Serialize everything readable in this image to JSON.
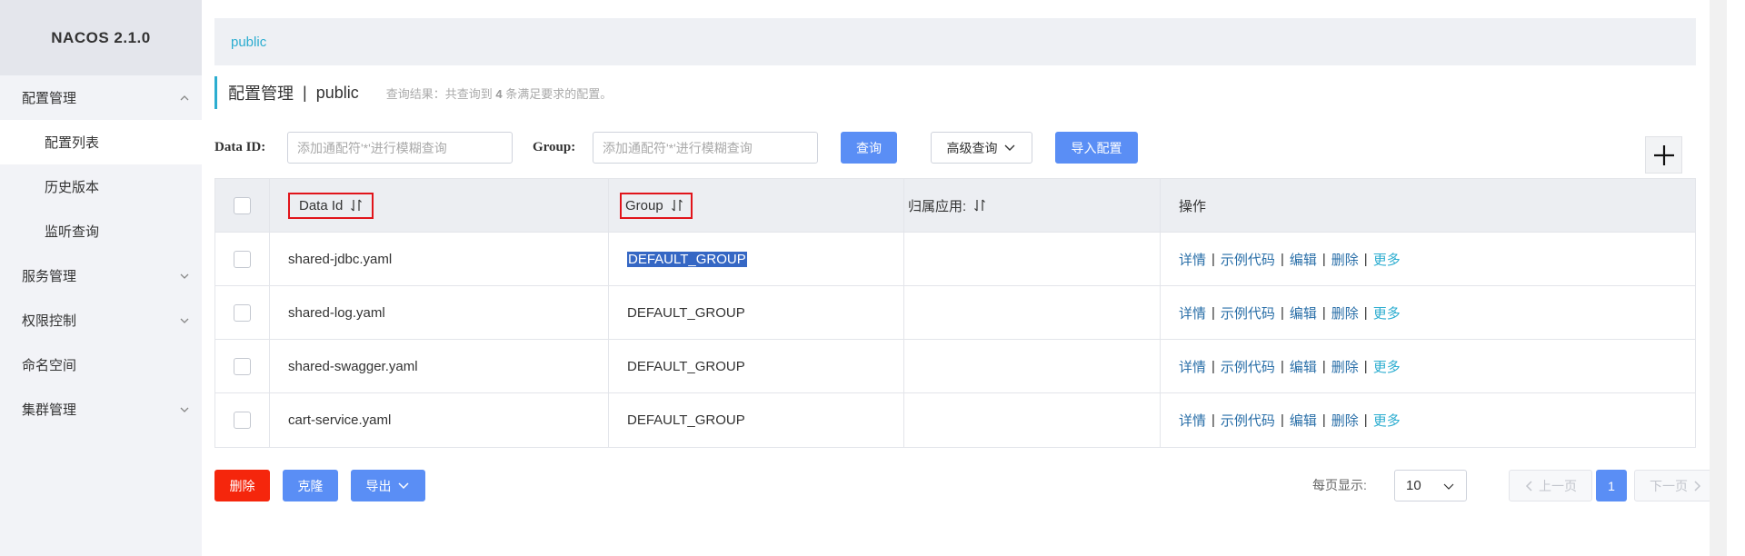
{
  "app": {
    "brand": "NACOS 2.1.0"
  },
  "sidebar": {
    "items": [
      {
        "label": "配置管理",
        "expanded": true
      },
      {
        "label": "配置列表",
        "sub": true,
        "active": true
      },
      {
        "label": "历史版本",
        "sub": true
      },
      {
        "label": "监听查询",
        "sub": true
      },
      {
        "label": "服务管理",
        "expanded": false
      },
      {
        "label": "权限控制",
        "expanded": false
      },
      {
        "label": "命名空间"
      },
      {
        "label": "集群管理",
        "expanded": false
      }
    ]
  },
  "breadcrumb": {
    "namespace": "public"
  },
  "title": {
    "main": "配置管理",
    "separator": "|",
    "namespace": "public",
    "result_prefix": "查询结果：共查询到",
    "result_count": "4",
    "result_suffix": "条满足要求的配置。"
  },
  "search": {
    "dataid_label": "Data ID:",
    "dataid_placeholder": "添加通配符'*'进行模糊查询",
    "group_label": "Group:",
    "group_placeholder": "添加通配符'*'进行模糊查询",
    "query_button": "查询",
    "advanced_button": "高级查询",
    "import_button": "导入配置"
  },
  "table": {
    "headers": {
      "data_id": "Data Id",
      "group": "Group",
      "app": "归属应用:",
      "ops": "操作"
    },
    "rows": [
      {
        "data_id": "shared-jdbc.yaml",
        "group": "DEFAULT_GROUP",
        "app": "",
        "highlighted": true
      },
      {
        "data_id": "shared-log.yaml",
        "group": "DEFAULT_GROUP",
        "app": ""
      },
      {
        "data_id": "shared-swagger.yaml",
        "group": "DEFAULT_GROUP",
        "app": ""
      },
      {
        "data_id": "cart-service.yaml",
        "group": "DEFAULT_GROUP",
        "app": ""
      }
    ],
    "ops": {
      "detail": "详情",
      "sample": "示例代码",
      "edit": "编辑",
      "delete": "删除",
      "more": "更多"
    }
  },
  "footer": {
    "delete_button": "删除",
    "clone_button": "克隆",
    "export_button": "导出",
    "per_page_label": "每页显示:",
    "per_page_value": "10",
    "prev": "上一页",
    "current_page": "1",
    "next": "下一页"
  },
  "colors": {
    "accent": "#2cadd0",
    "primary": "#5a8ef5",
    "danger": "#f5260c",
    "annotation_red": "#e1141b"
  }
}
